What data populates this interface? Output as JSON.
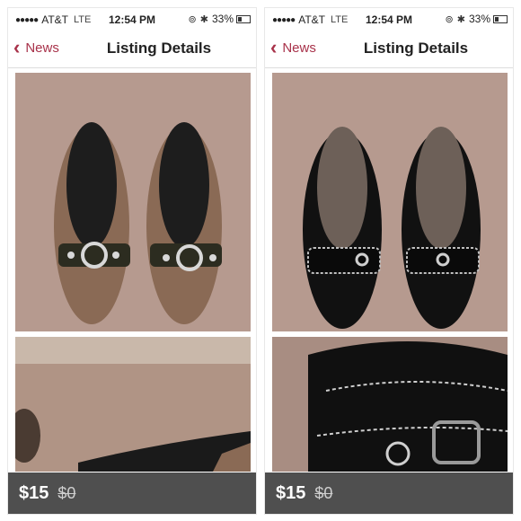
{
  "panels": [
    {
      "status": {
        "carrier": "AT&T",
        "network": "LTE",
        "time": "12:54 PM",
        "battery": "33%"
      },
      "nav": {
        "back_label": "News",
        "title": "Listing Details"
      },
      "price": {
        "current": "$15",
        "original": "$0"
      },
      "shoe_color": "#8a6a55"
    },
    {
      "status": {
        "carrier": "AT&T",
        "network": "LTE",
        "time": "12:54 PM",
        "battery": "33%"
      },
      "nav": {
        "back_label": "News",
        "title": "Listing Details"
      },
      "price": {
        "current": "$15",
        "original": "$0"
      },
      "shoe_color": "#141414"
    }
  ],
  "colors": {
    "accent": "#a8324a",
    "carpet": "#b99e93",
    "price_bar": "#282828"
  }
}
